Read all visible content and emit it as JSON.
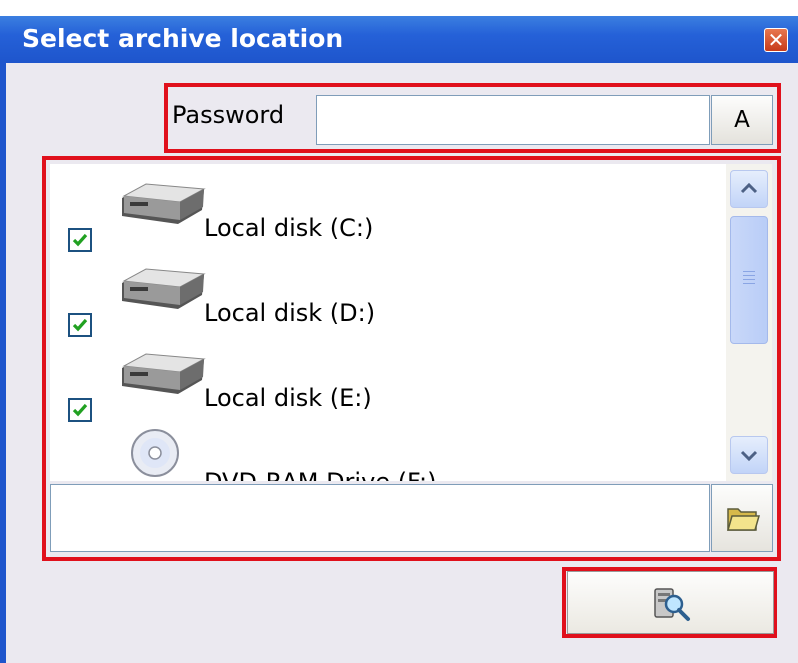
{
  "window": {
    "title": "Select archive location",
    "close_icon": "close-icon",
    "title_bar_color": "#2561d8"
  },
  "password": {
    "label": "Password",
    "value": "",
    "toggle_button_label": "A"
  },
  "drives": [
    {
      "label": "Local disk (C:)",
      "checked": true,
      "icon": "hard-disk-icon"
    },
    {
      "label": "Local disk (D:)",
      "checked": true,
      "icon": "hard-disk-icon"
    },
    {
      "label": "Local disk (E:)",
      "checked": true,
      "icon": "hard-disk-icon"
    },
    {
      "label": "DVD-RAM Drive (F:)",
      "checked": false,
      "icon": "cd-dvd-icon"
    }
  ],
  "path": {
    "value": "",
    "browse_icon": "folder-icon"
  },
  "search_button": {
    "icon": "search-disk-icon"
  },
  "highlight_color": "#e0101c"
}
